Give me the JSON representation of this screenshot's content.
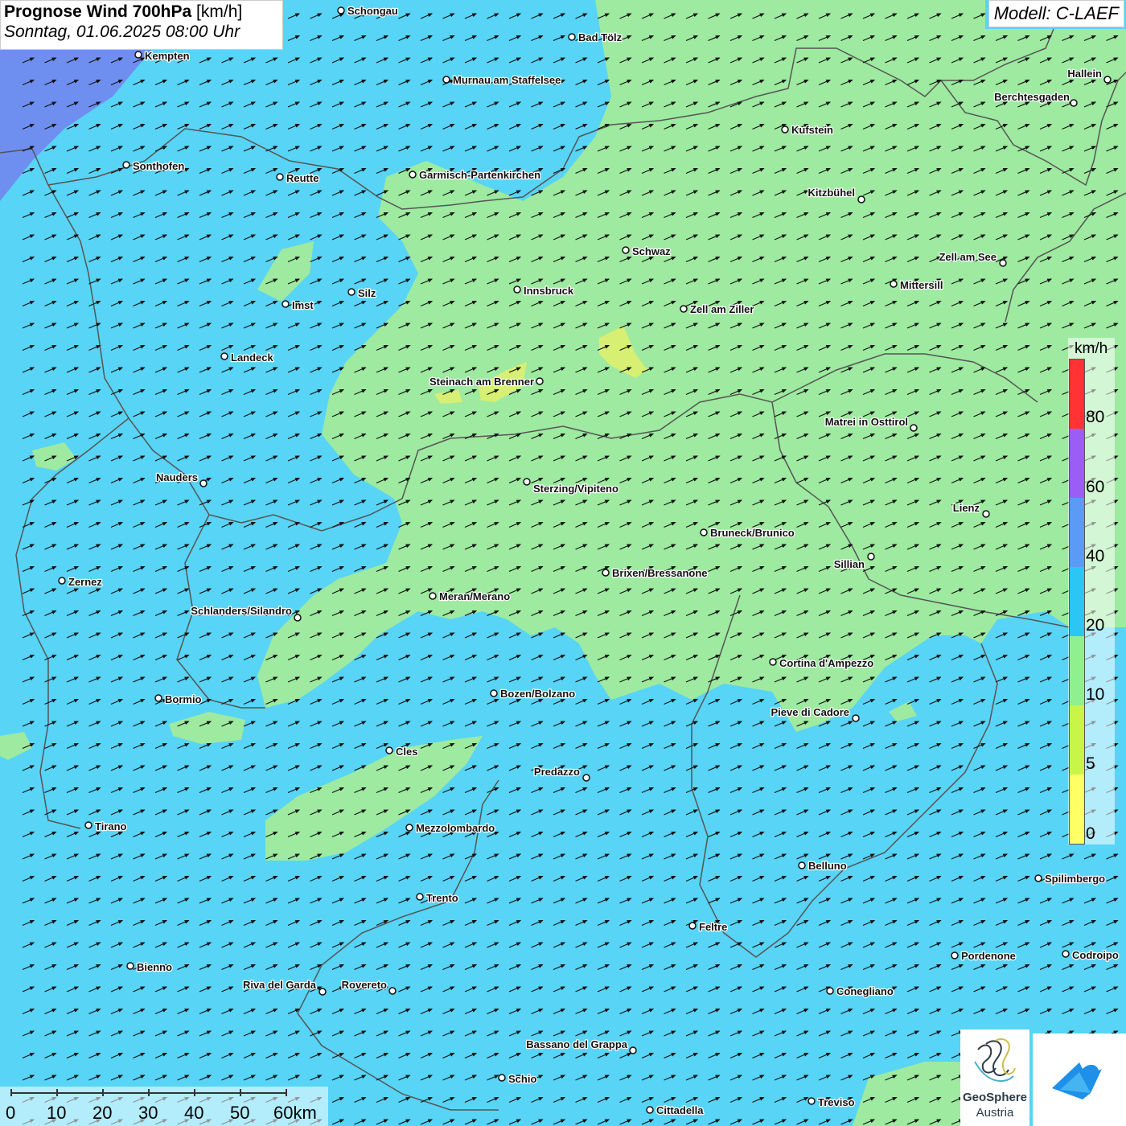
{
  "header": {
    "title_bold": "Prognose Wind 700hPa",
    "title_unit": "[km/h]",
    "datetime": "Sonntag, 01.06.2025 08:00 Uhr",
    "model": "Modell: C-LAEF"
  },
  "legend": {
    "unit": "km/h",
    "ticks": [
      "80",
      "60",
      "40",
      "20",
      "10",
      "5",
      "0"
    ],
    "colors": [
      "#ff3333",
      "#9b5df5",
      "#5b9bf5",
      "#2cc6f5",
      "#8ef08e",
      "#c8f54a",
      "#ffff66"
    ]
  },
  "colors": {
    "zone_light_blue": "#58d4f6",
    "zone_green": "#9eeaa0",
    "zone_violet_blue": "#6f8ff0",
    "zone_yellow": "#d7ef73",
    "border": "#555555"
  },
  "cities": [
    {
      "name": "Schongau"
    },
    {
      "name": "Bad Tölz"
    },
    {
      "name": "Kempten"
    },
    {
      "name": "Murnau am Staffelsee"
    },
    {
      "name": "Hallein"
    },
    {
      "name": "Berchtesgaden"
    },
    {
      "name": "Kufstein"
    },
    {
      "name": "Sonthofen"
    },
    {
      "name": "Reutte"
    },
    {
      "name": "Garmisch-Partenkirchen"
    },
    {
      "name": "Kitzbühel"
    },
    {
      "name": "Schwaz"
    },
    {
      "name": "Zell am See"
    },
    {
      "name": "Silz"
    },
    {
      "name": "Innsbruck"
    },
    {
      "name": "Mittersill"
    },
    {
      "name": "Imst"
    },
    {
      "name": "Zell am Ziller"
    },
    {
      "name": "Landeck"
    },
    {
      "name": "Steinach am Brenner"
    },
    {
      "name": "Matrei in Osttirol"
    },
    {
      "name": "Nauders"
    },
    {
      "name": "Sterzing/Vipiteno"
    },
    {
      "name": "Lienz"
    },
    {
      "name": "Bruneck/Brunico"
    },
    {
      "name": "Sillian"
    },
    {
      "name": "Zernez"
    },
    {
      "name": "Brixen/Bressanone"
    },
    {
      "name": "Meran/Merano"
    },
    {
      "name": "Schlanders/Silandro"
    },
    {
      "name": "Cortina d'Ampezzo"
    },
    {
      "name": "Bormio"
    },
    {
      "name": "Bozen/Bolzano"
    },
    {
      "name": "Pieve di Cadore"
    },
    {
      "name": "Cles"
    },
    {
      "name": "Predazzo"
    },
    {
      "name": "Tirano"
    },
    {
      "name": "Mezzolombardo"
    },
    {
      "name": "Belluno"
    },
    {
      "name": "Spilimbergo"
    },
    {
      "name": "Trento"
    },
    {
      "name": "Feltre"
    },
    {
      "name": "Pordenone"
    },
    {
      "name": "Codroipo"
    },
    {
      "name": "Bienno"
    },
    {
      "name": "Riva del Garda"
    },
    {
      "name": "Rovereto"
    },
    {
      "name": "Conegliano"
    },
    {
      "name": "Bassano del Grappa"
    },
    {
      "name": "Schio"
    },
    {
      "name": "Treviso"
    },
    {
      "name": "Cittadella"
    }
  ],
  "scale": {
    "labels": [
      "0",
      "10",
      "20",
      "30",
      "40",
      "50",
      "60km"
    ]
  },
  "logos": {
    "geosphere_line1": "GeoSphere",
    "geosphere_line2": "Austria"
  }
}
